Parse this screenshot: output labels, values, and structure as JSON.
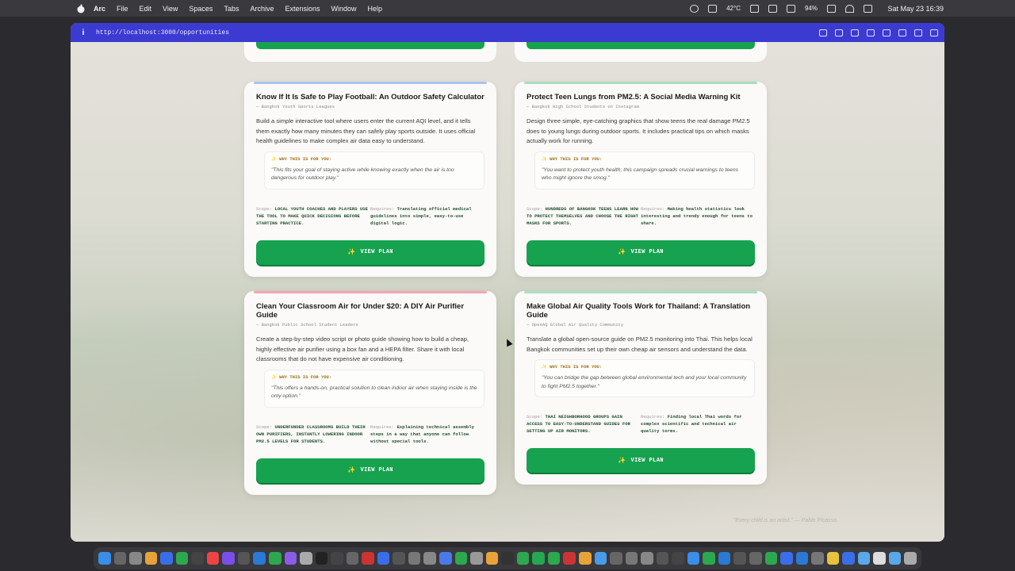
{
  "menubar": {
    "app": "Arc",
    "items": [
      "File",
      "Edit",
      "View",
      "Spaces",
      "Tabs",
      "Archive",
      "Extensions",
      "Window",
      "Help"
    ],
    "temperature": "42°C",
    "battery": "94%",
    "clock": "Sat May 23  16:39"
  },
  "browser": {
    "url": "http://localhost:3000/opportunities"
  },
  "cards": [
    {
      "accent": "#a9c4f0",
      "title": "Know If It Is Safe to Play Football: An Outdoor Safety Calculator",
      "org": "— Bangkok Youth Sports Leagues",
      "description": "Build a simple interactive tool where users enter the current AQI level, and it tells them exactly how many minutes they can safely play sports outside. It uses official health guidelines to make complex air data easy to understand.",
      "why_label": "✨ WHY THIS IS FOR YOU:",
      "why_text": "\"This fits your goal of staying active while knowing exactly when the air is too dangerous for outdoor play.\"",
      "scope_label": "Scope:",
      "scope": "LOCAL YOUTH COACHES AND PLAYERS USE THE TOOL TO MAKE QUICK DECISIONS BEFORE STARTING PRACTICE.",
      "requires_label": "Requires:",
      "requires": "Translating official medical guidelines into simple, easy-to-use digital logic.",
      "button": "VIEW PLAN"
    },
    {
      "accent": "#a8e0bf",
      "title": "Protect Teen Lungs from PM2.5: A Social Media Warning Kit",
      "org": "— Bangkok High School Students on Instagram",
      "description": "Design three simple, eye-catching graphics that show teens the real damage PM2.5 does to young lungs during outdoor sports. It includes practical tips on which masks actually work for running.",
      "why_label": "✨ WHY THIS IS FOR YOU:",
      "why_text": "\"You want to protect youth health; this campaign spreads crucial warnings to teens who might ignore the smog.\"",
      "scope_label": "Scope:",
      "scope": "HUNDREDS OF BANGKOK TEENS LEARN HOW TO PROTECT THEMSELVES AND CHOOSE THE RIGHT MASKS FOR SPORTS.",
      "requires_label": "Requires:",
      "requires": "Making health statistics look interesting and trendy enough for teens to share.",
      "button": "VIEW PLAN"
    },
    {
      "accent": "#f2a8ae",
      "title": "Clean Your Classroom Air for Under $20: A DIY Air Purifier Guide",
      "org": "— Bangkok Public School Student Leaders",
      "description": "Create a step-by-step video script or photo guide showing how to build a cheap, highly effective air purifier using a box fan and a HEPA filter. Share it with local classrooms that do not have expensive air conditioning.",
      "why_label": "✨ WHY THIS IS FOR YOU:",
      "why_text": "\"This offers a hands-on, practical solution to clean indoor air when staying inside is the only option.\"",
      "scope_label": "Scope:",
      "scope": "UNDERFUNDED CLASSROOMS BUILD THEIR OWN PURIFIERS, INSTANTLY LOWERING INDOOR PM2.5 LEVELS FOR STUDENTS.",
      "requires_label": "Requires:",
      "requires": "Explaining technical assembly steps in a way that anyone can follow without special tools.",
      "button": "VIEW PLAN"
    },
    {
      "accent": "#a8e0bf",
      "title": "Make Global Air Quality Tools Work for Thailand: A Translation Guide",
      "org": "— OpenAQ Global Air Quality Community",
      "description": "Translate a global open-source guide on PM2.5 monitoring into Thai. This helps local Bangkok communities set up their own cheap air sensors and understand the data.",
      "why_label": "✨ WHY THIS IS FOR YOU:",
      "why_text": "\"You can bridge the gap between global environmental tech and your local community to fight PM2.5 together.\"",
      "scope_label": "Scope:",
      "scope": "THAI NEIGHBORHOOD GROUPS GAIN ACCESS TO EASY-TO-UNDERSTAND GUIDES FOR SETTING UP AIR MONITORS.",
      "requires_label": "Requires:",
      "requires": "Finding local Thai words for complex scientific and technical air quality terms.",
      "button": "VIEW PLAN"
    }
  ],
  "footer": {
    "quote": "\"Every child is an artist.\" — Pablo Picasso"
  }
}
